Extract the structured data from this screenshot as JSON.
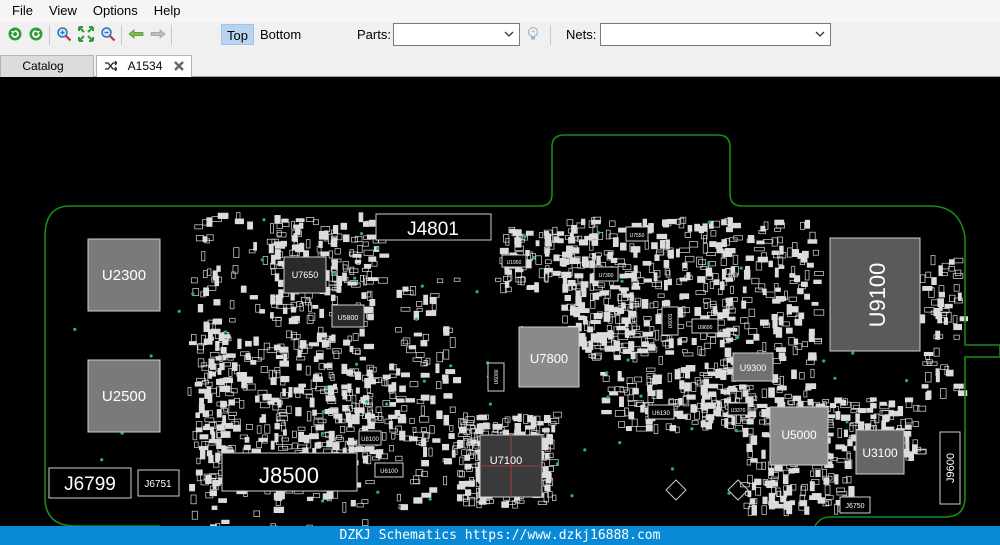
{
  "menu": {
    "file": "File",
    "view": "View",
    "options": "Options",
    "help": "Help"
  },
  "toolbar": {
    "icons": [
      "rotate-left-icon",
      "rotate-right-icon",
      "zoom-in-icon",
      "fit-icon",
      "zoom-out-icon",
      "back-arrow-icon",
      "forward-arrow-icon"
    ],
    "top_label": "Top",
    "bottom_label": "Bottom",
    "active_layer": "Top",
    "parts_label": "Parts:",
    "parts_value": "",
    "nets_label": "Nets:",
    "nets_value": "",
    "search_icon": "lightbulb-icon"
  },
  "tabs": {
    "catalog": "Catalog",
    "board": "A1534"
  },
  "board": {
    "outline_color": "#1a8a1a",
    "silk_color": "#dcdcdc",
    "components": {
      "u2300": "U2300",
      "u2500": "U2500",
      "j6799": "J6799",
      "j6751": "J6751",
      "j8500": "J8500",
      "j4801": "J4801",
      "u7650": "U7650",
      "u5800": "U5800",
      "u7800": "U7800",
      "u7100": "U7100",
      "u9100": "U9100",
      "u9300": "U9300",
      "u5000": "U5000",
      "u3100": "U3100",
      "j9600": "J9600",
      "u6100": "U6100",
      "j6750": "J6750",
      "u8100": "U8100",
      "u1950": "U1950",
      "u9600": "U9600",
      "u6130": "U6130",
      "u3370": "U3370",
      "u7300": "U7300",
      "u7550": "U7550",
      "u6001": "U6001",
      "u6000": "U6000"
    }
  },
  "footer": {
    "text": "DZKJ Schematics https://www.dzkj16888.com"
  }
}
